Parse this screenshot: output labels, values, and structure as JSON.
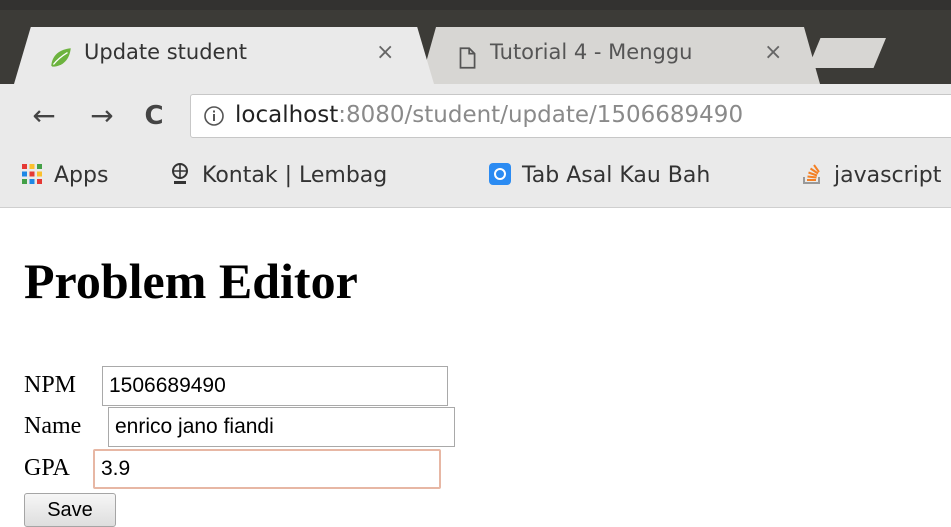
{
  "browser": {
    "tabs": [
      {
        "title": "Update student",
        "close": "×",
        "active": true
      },
      {
        "title": "Tutorial 4 - Menggu",
        "close": "×",
        "active": false
      }
    ],
    "nav": {
      "back": "←",
      "forward": "→",
      "reload": "C"
    },
    "address": {
      "host": "localhost",
      "path": ":8080/student/update/1506689490"
    },
    "bookmarks": [
      {
        "label": "Apps",
        "icon": "apps-grid-icon"
      },
      {
        "label": "Kontak | Lembag",
        "icon": "lipi-logo-icon"
      },
      {
        "label": "Tab Asal Kau Bah",
        "icon": "blue-app-icon"
      },
      {
        "label": "javascript",
        "icon": "stackoverflow-icon"
      }
    ]
  },
  "page": {
    "heading": "Problem Editor",
    "form": {
      "npm": {
        "label": "NPM",
        "value": "1506689490"
      },
      "name": {
        "label": "Name",
        "value": "enrico jano fiandi"
      },
      "gpa": {
        "label": "GPA",
        "value": "3.9"
      },
      "submit_label": "Save"
    }
  },
  "colors": {
    "tabstrip": "#3c3b37",
    "chrome": "#eaeaea",
    "focus_border": "#e7b7a4"
  }
}
